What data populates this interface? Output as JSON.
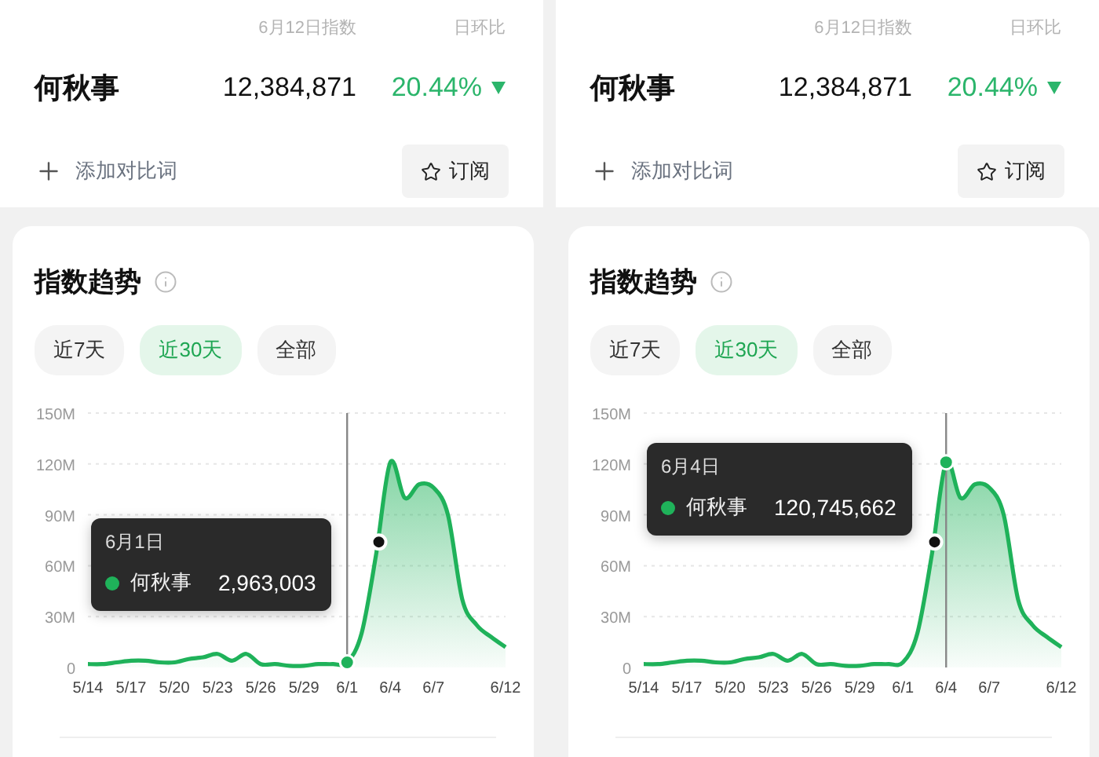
{
  "panels": [
    {
      "header": {
        "date_label": "6月12日指数",
        "change_label": "日环比"
      },
      "keyword": {
        "name": "何秋事",
        "index": "12,384,871",
        "change": "20.44%",
        "falling": true
      },
      "add_compare": "添加对比词",
      "subscribe": "订阅",
      "card": {
        "title": "指数趋势",
        "ranges": [
          {
            "label": "近7天",
            "selected": false
          },
          {
            "label": "近30天",
            "selected": true
          },
          {
            "label": "全部",
            "selected": false
          }
        ],
        "chart_data": {
          "type": "area",
          "categories": [
            "5/14",
            null,
            null,
            "5/17",
            null,
            null,
            "5/20",
            null,
            null,
            "5/23",
            null,
            null,
            "5/26",
            null,
            null,
            "5/29",
            null,
            null,
            "6/1",
            null,
            null,
            "6/4",
            null,
            null,
            "6/7",
            null,
            null,
            null,
            null,
            "6/12"
          ],
          "series": [
            {
              "name": "何秋事",
              "color": "#1fb25a",
              "values": [
                2,
                2,
                3,
                4,
                4,
                3,
                3,
                5,
                6,
                8,
                4,
                8,
                2,
                2,
                1,
                1,
                2,
                2,
                3,
                20,
                66,
                121,
                100,
                108,
                106,
                90,
                40,
                25,
                18,
                12
              ]
            }
          ],
          "ylim": [
            0,
            150
          ],
          "yticks": [
            {
              "value": 0,
              "label": "0"
            },
            {
              "value": 30,
              "label": "30M"
            },
            {
              "value": 60,
              "label": "60M"
            },
            {
              "value": 90,
              "label": "90M"
            },
            {
              "value": 120,
              "label": "120M"
            },
            {
              "value": 150,
              "label": "150M"
            }
          ],
          "grid": true,
          "ref_lines": [
            {
              "axis": "x",
              "value": "6/1",
              "color": "#888888"
            }
          ]
        },
        "tooltip": {
          "date": "6月1日",
          "value": "2,963,003"
        }
      }
    },
    {
      "header": {
        "date_label": "6月12日指数",
        "change_label": "日环比"
      },
      "keyword": {
        "name": "何秋事",
        "index": "12,384,871",
        "change": "20.44%",
        "falling": true
      },
      "add_compare": "添加对比词",
      "subscribe": "订阅",
      "card": {
        "title": "指数趋势",
        "ranges": [
          {
            "label": "近7天",
            "selected": false
          },
          {
            "label": "近30天",
            "selected": true
          },
          {
            "label": "全部",
            "selected": false
          }
        ],
        "chart_data": {
          "type": "area",
          "categories": [
            "5/14",
            null,
            null,
            "5/17",
            null,
            null,
            "5/20",
            null,
            null,
            "5/23",
            null,
            null,
            "5/26",
            null,
            null,
            "5/29",
            null,
            null,
            "6/1",
            null,
            null,
            "6/4",
            null,
            null,
            "6/7",
            null,
            null,
            null,
            null,
            "6/12"
          ],
          "series": [
            {
              "name": "何秋事",
              "color": "#1fb25a",
              "values": [
                2,
                2,
                3,
                4,
                4,
                3,
                3,
                5,
                6,
                8,
                4,
                8,
                2,
                2,
                1,
                1,
                2,
                2,
                3,
                20,
                66,
                121,
                100,
                108,
                106,
                90,
                40,
                25,
                18,
                12
              ]
            }
          ],
          "ylim": [
            0,
            150
          ],
          "yticks": [
            {
              "value": 0,
              "label": "0"
            },
            {
              "value": 30,
              "label": "30M"
            },
            {
              "value": 60,
              "label": "60M"
            },
            {
              "value": 90,
              "label": "90M"
            },
            {
              "value": 120,
              "label": "120M"
            },
            {
              "value": 150,
              "label": "150M"
            }
          ],
          "grid": true,
          "ref_lines": [
            {
              "axis": "x",
              "value": "6/4",
              "color": "#888888"
            }
          ]
        },
        "tooltip": {
          "date": "6月4日",
          "value": "120,745,662"
        }
      }
    }
  ]
}
